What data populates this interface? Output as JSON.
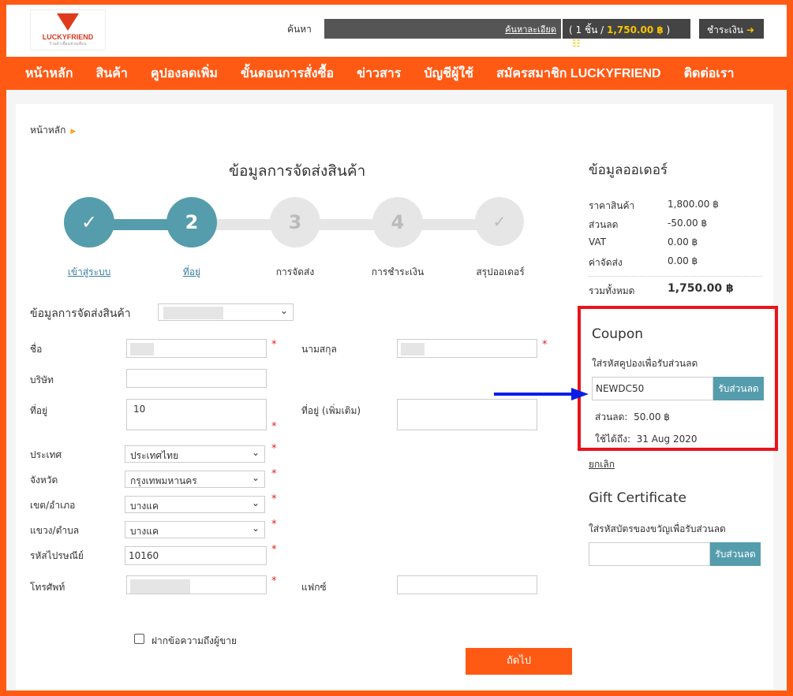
{
  "header": {
    "logo_brand": "LUCKYFRIEND",
    "logo_tagline": "ร้านค้าเพื่อนช่วยเพื่อน",
    "search_label": "ค้นหา",
    "search_advanced": "ค้นหาละเอียด",
    "cart_prefix": "( 1 ชิ้น / ",
    "cart_amount": "1,750.00 ฿",
    "cart_suffix": " )",
    "checkout_label": "ชำระเงิน"
  },
  "nav": {
    "items": [
      "หน้าหลัก",
      "สินค้า",
      "คูปองลดเพิ่ม",
      "ขั้นตอนการสั่งซื้อ",
      "ข่าวสาร",
      "บัญชีผู้ใช้",
      "สมัครสมาชิก LUCKYFRIEND",
      "ติดต่อเรา"
    ]
  },
  "breadcrumb": {
    "home": "หน้าหลัก"
  },
  "form": {
    "title": "ข้อมูลการจัดส่งสินค้า",
    "steps": [
      {
        "num": "✓",
        "label": "เข้าสู่ระบบ"
      },
      {
        "num": "2",
        "label": "ที่อยู่"
      },
      {
        "num": "3",
        "label": "การจัดส่ง"
      },
      {
        "num": "4",
        "label": "การชำระเงิน"
      },
      {
        "num": "✓",
        "label": "สรุปออเดอร์"
      }
    ],
    "address_select_label": "ข้อมูลการจัดส่งสินค้า",
    "first_name_label": "ชื่อ",
    "last_name_label": "นามสกุล",
    "company_label": "บริษัท",
    "address_label": "ที่อยู่",
    "address_value": "10",
    "address2_label": "ที่อยู่ (เพิ่มเติม)",
    "country_label": "ประเทศ",
    "country_value": "ประเทศไทย",
    "province_label": "จังหวัด",
    "province_value": "กรุงเทพมหานคร",
    "district_label": "เขต/อำเภอ",
    "district_value": "บางแค",
    "subdistrict_label": "แขวง/ตำบล",
    "subdistrict_value": "บางแค",
    "postcode_label": "รหัสไปรษณีย์",
    "postcode_value": "10160",
    "phone_label": "โทรศัพท์",
    "fax_label": "แฟกซ์",
    "message_checkbox_label": "ฝากข้อความถึงผู้ขาย",
    "next_button": "ถัดไป",
    "required_mark": "*"
  },
  "order": {
    "title": "ข้อมูลออเดอร์",
    "rows": [
      {
        "label": "ราคาสินค้า",
        "value": "1,800.00 ฿"
      },
      {
        "label": "ส่วนลด",
        "value": "-50.00 ฿"
      },
      {
        "label": "VAT",
        "value": "0.00 ฿"
      },
      {
        "label": "ค่าจัดส่ง",
        "value": "0.00 ฿"
      }
    ],
    "total_label": "รวมทั้งหมด",
    "total_value": "1,750.00 ฿"
  },
  "coupon": {
    "title": "Coupon",
    "description": "ใส่รหัสคูปองเพื่อรับส่วนลด",
    "code": "NEWDC50",
    "apply_button": "รับส่วนลด",
    "discount_label": "ส่วนลด:",
    "discount_value": "50.00 ฿",
    "expiry_label": "ใช้ได้ถึง:",
    "expiry_value": "31 Aug 2020",
    "cancel_link": "ยกเลิก",
    "highlight_color": "#e8141c",
    "arrow_color": "#0a1ee8"
  },
  "gift": {
    "title": "Gift Certificate",
    "description": "ใส่รหัสบัตรของขวัญเพื่อรับส่วนลด",
    "apply_button": "รับส่วนลด"
  },
  "colors": {
    "brand_orange": "#ff5a14",
    "step_teal": "#559dac",
    "accent_yellow": "#f5c400"
  }
}
